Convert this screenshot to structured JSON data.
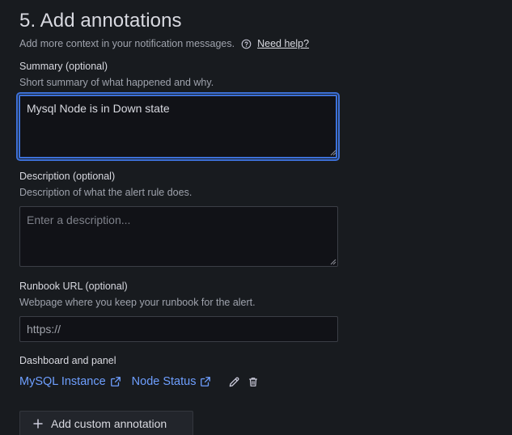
{
  "section": {
    "title": "5. Add annotations",
    "subtitle": "Add more context in your notification messages.",
    "help_link": "Need help?"
  },
  "summary": {
    "label": "Summary (optional)",
    "description": "Short summary of what happened and why.",
    "value": "Mysql Node is in Down state"
  },
  "description": {
    "label": "Description (optional)",
    "description": "Description of what the alert rule does.",
    "placeholder": "Enter a description..."
  },
  "runbook": {
    "label": "Runbook URL (optional)",
    "description": "Webpage where you keep your runbook for the alert.",
    "placeholder": "https://"
  },
  "dashboard_panel": {
    "label": "Dashboard and panel",
    "dashboard_link": "MySQL Instance",
    "panel_link": "Node Status"
  },
  "add_button": {
    "label": "Add custom annotation"
  },
  "colors": {
    "background": "#181b1f",
    "link": "#6e9fff",
    "focus": "#3d71d9"
  }
}
